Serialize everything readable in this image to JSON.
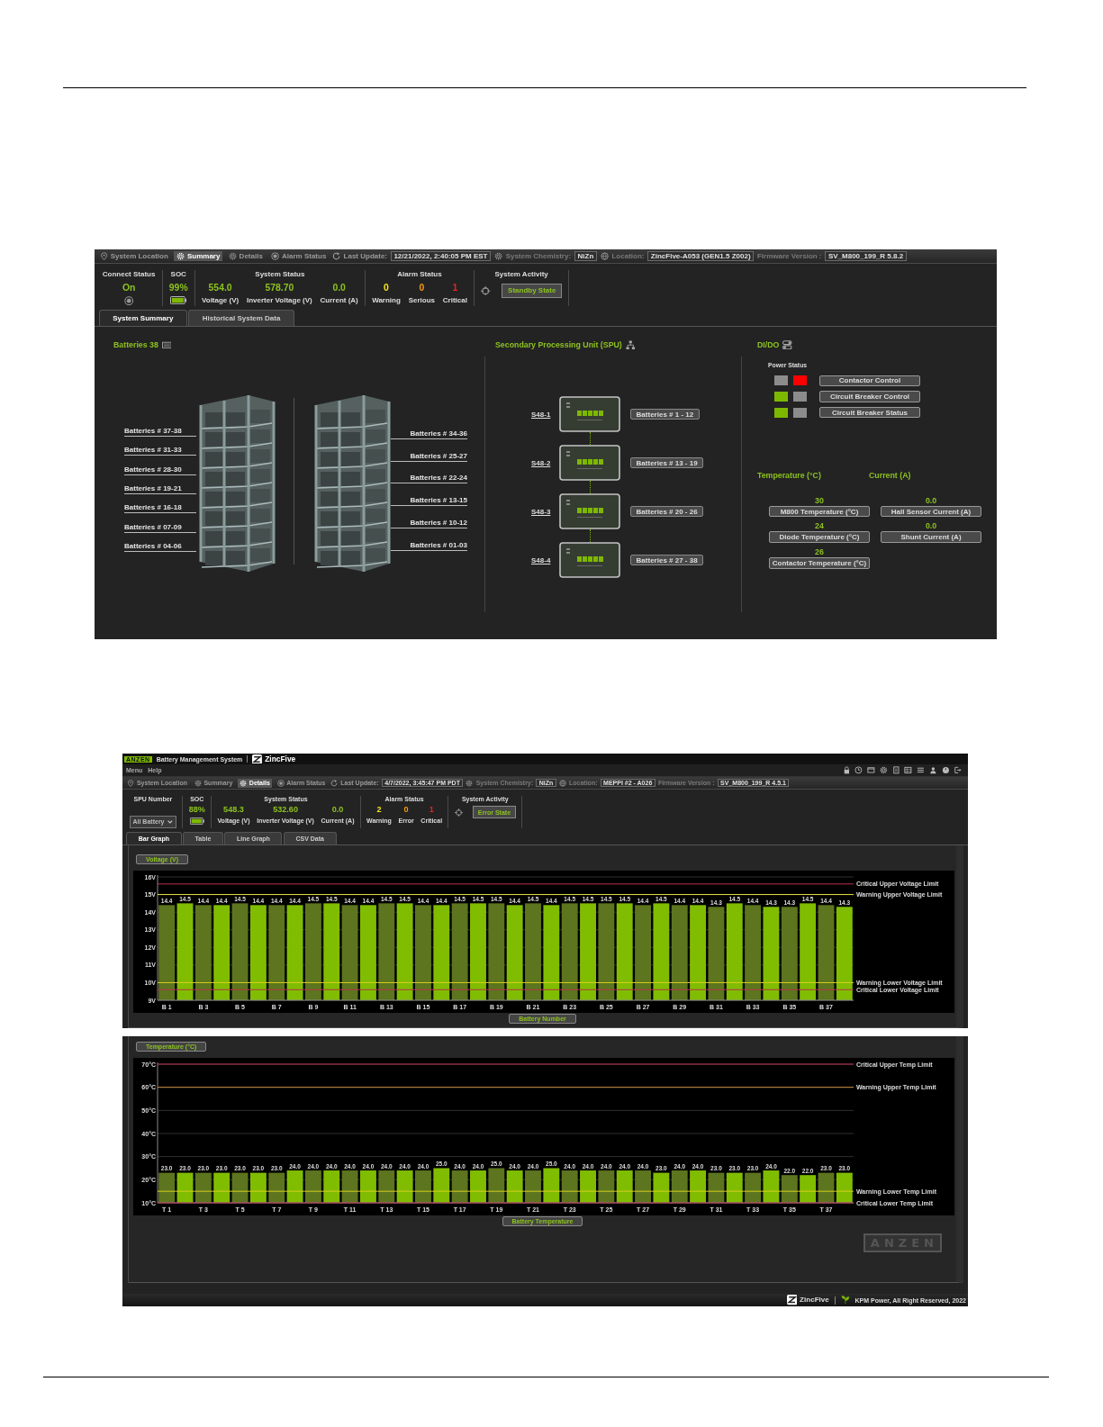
{
  "summary_screen": {
    "nav": [
      {
        "kind": "item",
        "label": "System Location",
        "selected": false
      },
      {
        "kind": "item",
        "label": "Summary",
        "selected": true
      },
      {
        "kind": "item",
        "label": "Details",
        "selected": false
      },
      {
        "kind": "item",
        "label": "Alarm Status",
        "selected": false
      },
      {
        "kind": "field",
        "label": "Last Update:",
        "value": "12/21/2022, 2:40:05 PM EST"
      },
      {
        "kind": "field",
        "label": "System Chemistry:",
        "value": "NiZn"
      },
      {
        "kind": "field",
        "label": "Location:",
        "value": "ZincFive-A053 (GEN1.5 Z002)"
      },
      {
        "kind": "field",
        "label": "Firmware Version :",
        "value": "SV_M800_199_R 5.8.2"
      }
    ],
    "status": [
      {
        "kind": "connect",
        "title": "Connect Status",
        "value": "On"
      },
      {
        "kind": "soc",
        "title": "SOC",
        "value": "99%"
      },
      {
        "kind": "readings",
        "title": "System Status",
        "items": [
          {
            "value": "554.0",
            "label": "Voltage (V)"
          },
          {
            "value": "578.70",
            "label": "Inverter Voltage (V)"
          },
          {
            "value": "0.0",
            "label": "Current (A)"
          }
        ]
      },
      {
        "kind": "alarms",
        "title": "Alarm Status",
        "items": [
          {
            "value": "0",
            "label": "Warning",
            "color": "#f2e21a"
          },
          {
            "value": "0",
            "label": "Serious",
            "color": "#f59a0c"
          },
          {
            "value": "1",
            "label": "Critical",
            "color": "#e8231c"
          }
        ]
      },
      {
        "kind": "activity",
        "title": "System Activity",
        "state": "Standby State"
      }
    ],
    "tabs": [
      {
        "label": "System Summary",
        "selected": true
      },
      {
        "label": "Historical System Data",
        "selected": false
      }
    ],
    "batteries": {
      "title": "Batteries 38",
      "left_labels": [
        "Batteries # 37-38",
        "Batteries # 31-33",
        "Batteries # 28-30",
        "Batteries # 19-21",
        "Batteries # 16-18",
        "Batteries # 07-09",
        "Batteries # 04-06"
      ],
      "right_labels": [
        "Batteries # 34-36",
        "Batteries # 25-27",
        "Batteries # 22-24",
        "Batteries # 13-15",
        "Batteries # 10-12",
        "Batteries # 01-03"
      ]
    },
    "spu": {
      "title": "Secondary Processing Unit (SPU)",
      "units": [
        {
          "name": "S48-1",
          "range": "Batteries # 1 - 12"
        },
        {
          "name": "S48-2",
          "range": "Batteries # 13 - 19"
        },
        {
          "name": "S48-3",
          "range": "Batteries # 20 - 26"
        },
        {
          "name": "S48-4",
          "range": "Batteries # 27 - 38"
        }
      ]
    },
    "dido": {
      "title": "DI/DO",
      "power_status_title": "Power Status",
      "controls": [
        {
          "indicators": [
            {
              "color": "#8c8c8c"
            },
            {
              "color": "#ff0000"
            }
          ],
          "label": "Contactor Control"
        },
        {
          "indicators": [
            {
              "color": "#7db800"
            },
            {
              "color": "#8c8c8c"
            }
          ],
          "label": "Circuit Breaker Control"
        },
        {
          "indicators": [
            {
              "color": "#7db800"
            },
            {
              "color": "#8c8c8c"
            }
          ],
          "label": "Circuit Breaker Status"
        }
      ],
      "temperature": {
        "title": "Temperature (°C)",
        "items": [
          {
            "value": "30",
            "label": "M800 Temperature (°C)"
          },
          {
            "value": "24",
            "label": "Diode Temperature (°C)"
          },
          {
            "value": "26",
            "label": "Contactor Temperature (°C)"
          }
        ]
      },
      "current": {
        "title": "Current (A)",
        "items": [
          {
            "value": "0.0",
            "label": "Hall Sensor Current (A)"
          },
          {
            "value": "0.0",
            "label": "Shunt Current (A)"
          }
        ]
      }
    }
  },
  "details_screen": {
    "header": {
      "logo": "ANZEN",
      "title": "Battery Management System",
      "brand": "ZincFive",
      "menu": [
        "Menu",
        "Help"
      ]
    },
    "nav": [
      {
        "kind": "item",
        "label": "System Location",
        "selected": false
      },
      {
        "kind": "item",
        "label": "Summary",
        "selected": false
      },
      {
        "kind": "item",
        "label": "Details",
        "selected": true
      },
      {
        "kind": "item",
        "label": "Alarm Status",
        "selected": false
      },
      {
        "kind": "field",
        "label": "Last Update:",
        "value": "4/7/2022, 3:45:47 PM PDT"
      },
      {
        "kind": "field",
        "label": "System Chemistry:",
        "value": "NiZn"
      },
      {
        "kind": "field",
        "label": "Location:",
        "value": "MEPPI #2 - A026"
      },
      {
        "kind": "field",
        "label": "Firmware Version :",
        "value": "SV_M800_199_R 4.5.1"
      }
    ],
    "status": [
      {
        "kind": "spu",
        "title": "SPU Number",
        "value": "All Battery"
      },
      {
        "kind": "soc",
        "title": "SOC",
        "value": "88%"
      },
      {
        "kind": "readings",
        "title": "System Status",
        "items": [
          {
            "value": "548.3",
            "label": "Voltage (V)"
          },
          {
            "value": "532.60",
            "label": "Inverter Voltage (V)"
          },
          {
            "value": "0.0",
            "label": "Current (A)"
          }
        ]
      },
      {
        "kind": "alarms",
        "title": "Alarm Status",
        "items": [
          {
            "value": "2",
            "label": "Warning",
            "color": "#f2e21a"
          },
          {
            "value": "0",
            "label": "Error",
            "color": "#f59a0c"
          },
          {
            "value": "1",
            "label": "Critical",
            "color": "#e8231c"
          }
        ]
      },
      {
        "kind": "activity",
        "title": "System Activity",
        "state": "Error State"
      }
    ],
    "tabs": [
      {
        "label": "Bar Graph",
        "selected": true
      },
      {
        "label": "Table",
        "selected": false
      },
      {
        "label": "Line Graph",
        "selected": false
      },
      {
        "label": "CSV Data",
        "selected": false
      }
    ],
    "charts": [
      {
        "chart_data": {
          "type": "bar",
          "title": "Voltage (V)",
          "xlabel": "Battery Number",
          "categories": [
            "B 1",
            null,
            "B 3",
            null,
            "B 5",
            null,
            "B 7",
            null,
            "B 9",
            null,
            "B 11",
            null,
            "B 13",
            null,
            "B 15",
            null,
            "B 17",
            null,
            "B 19",
            null,
            "B 21",
            null,
            "B 23",
            null,
            "B 25",
            null,
            "B 27",
            null,
            "B 29",
            null,
            "B 31",
            null,
            "B 33",
            null,
            "B 35",
            null,
            "B 37",
            null
          ],
          "grid": true,
          "series": [
            {
              "color": "#5c751e",
              "values": [
                14.4,
                null,
                14.4,
                null,
                14.5,
                null,
                14.4,
                null,
                14.5,
                null,
                14.4,
                null,
                14.5,
                null,
                14.4,
                null,
                14.5,
                null,
                14.5,
                null,
                14.5,
                null,
                14.5,
                null,
                14.5,
                null,
                14.4,
                null,
                14.4,
                null,
                14.3,
                null,
                14.4,
                null,
                14.3,
                null,
                14.4,
                null
              ],
              "value_labels": [
                "14.4",
                null,
                "14.4",
                null,
                "14.5",
                null,
                "14.4",
                null,
                "14.5",
                null,
                "14.4",
                null,
                "14.5",
                null,
                "14.4",
                null,
                "14.5",
                null,
                "14.5",
                null,
                "14.5",
                null,
                "14.5",
                null,
                "14.5",
                null,
                "14.4",
                null,
                "14.4",
                null,
                "14.3",
                null,
                "14.4",
                null,
                "14.3",
                null,
                "14.4",
                null
              ]
            },
            {
              "color": "#80bd00",
              "values": [
                null,
                14.5,
                null,
                14.4,
                null,
                14.4,
                null,
                14.4,
                null,
                14.5,
                null,
                14.4,
                null,
                14.5,
                null,
                14.4,
                null,
                14.5,
                null,
                14.4,
                null,
                14.4,
                null,
                14.5,
                null,
                14.5,
                null,
                14.5,
                null,
                14.4,
                null,
                14.5,
                null,
                14.3,
                null,
                14.5,
                null,
                14.3
              ],
              "value_labels": [
                null,
                "14.5",
                null,
                "14.4",
                null,
                "14.4",
                null,
                "14.4",
                null,
                "14.5",
                null,
                "14.4",
                null,
                "14.5",
                null,
                "14.4",
                null,
                "14.5",
                null,
                "14.4",
                null,
                "14.4",
                null,
                "14.5",
                null,
                "14.5",
                null,
                "14.5",
                null,
                "14.4",
                null,
                "14.5",
                null,
                "14.3",
                null,
                "14.5",
                null,
                "14.3"
              ]
            }
          ],
          "ylim": [
            9,
            16
          ],
          "yticks": [
            {
              "value": 9,
              "label": "9V"
            },
            {
              "value": 10,
              "label": "10V"
            },
            {
              "value": 11,
              "label": "11V"
            },
            {
              "value": 12,
              "label": "12V"
            },
            {
              "value": 13,
              "label": "13V"
            },
            {
              "value": 14,
              "label": "14V"
            },
            {
              "value": 15,
              "label": "15V"
            },
            {
              "value": 16,
              "label": "16V"
            }
          ],
          "ref_lines": [
            {
              "axis": "y",
              "value": 15.6,
              "label": "Critical Upper Voltage Limit",
              "color": "#b8304c"
            },
            {
              "axis": "y",
              "value": 15,
              "label": "Warning Upper Voltage Limit",
              "color": "#e8e040"
            },
            {
              "axis": "y",
              "value": 10,
              "label": "Warning Lower Voltage Limit",
              "color": "#d8d020"
            },
            {
              "axis": "y",
              "value": 9.6,
              "label": "Critical Lower Voltage Limit",
              "color": "#b8304c"
            }
          ]
        }
      },
      {
        "chart_data": {
          "type": "bar",
          "title": "Temperature (°C)",
          "xlabel": "Battery Temperature",
          "categories": [
            "T 1",
            null,
            "T 3",
            null,
            "T 5",
            null,
            "T 7",
            null,
            "T 9",
            null,
            "T 11",
            null,
            "T 13",
            null,
            "T 15",
            null,
            "T 17",
            null,
            "T 19",
            null,
            "T 21",
            null,
            "T 23",
            null,
            "T 25",
            null,
            "T 27",
            null,
            "T 29",
            null,
            "T 31",
            null,
            "T 33",
            null,
            "T 35",
            null,
            "T 37",
            null
          ],
          "grid": true,
          "series": [
            {
              "color": "#5c751e",
              "values": [
                23,
                null,
                23,
                null,
                23,
                null,
                23,
                null,
                24,
                null,
                24,
                null,
                24,
                null,
                24,
                null,
                24,
                null,
                25,
                null,
                24,
                null,
                24,
                null,
                24,
                null,
                24,
                null,
                24,
                null,
                23,
                null,
                23,
                null,
                22,
                null,
                23,
                null
              ],
              "value_labels": [
                "23.0",
                null,
                "23.0",
                null,
                "23.0",
                null,
                "23.0",
                null,
                "24.0",
                null,
                "24.0",
                null,
                "24.0",
                null,
                "24.0",
                null,
                "24.0",
                null,
                "25.0",
                null,
                "24.0",
                null,
                "24.0",
                null,
                "24.0",
                null,
                "24.0",
                null,
                "24.0",
                null,
                "23.0",
                null,
                "23.0",
                null,
                "22.0",
                null,
                "23.0",
                null
              ]
            },
            {
              "color": "#80bd00",
              "values": [
                null,
                23,
                null,
                23,
                null,
                23,
                null,
                24,
                null,
                24,
                null,
                24,
                null,
                24,
                null,
                25,
                null,
                24,
                null,
                24,
                null,
                25,
                null,
                24,
                null,
                24,
                null,
                23,
                null,
                24,
                null,
                23,
                null,
                24,
                null,
                22,
                null,
                23
              ],
              "value_labels": [
                null,
                "23.0",
                null,
                "23.0",
                null,
                "23.0",
                null,
                "24.0",
                null,
                "24.0",
                null,
                "24.0",
                null,
                "24.0",
                null,
                "25.0",
                null,
                "24.0",
                null,
                "24.0",
                null,
                "25.0",
                null,
                "24.0",
                null,
                "24.0",
                null,
                "23.0",
                null,
                "24.0",
                null,
                "23.0",
                null,
                "24.0",
                null,
                "22.0",
                null,
                "23.0"
              ]
            }
          ],
          "ylim": [
            10,
            70
          ],
          "yticks": [
            {
              "value": 10,
              "label": "10°C"
            },
            {
              "value": 20,
              "label": "20°C"
            },
            {
              "value": 30,
              "label": "30°C"
            },
            {
              "value": 40,
              "label": "40°C"
            },
            {
              "value": 50,
              "label": "50°C"
            },
            {
              "value": 60,
              "label": "60°C"
            },
            {
              "value": 70,
              "label": "70°C"
            }
          ],
          "ref_lines": [
            {
              "axis": "y",
              "value": 70,
              "label": "Critical Upper Temp Limit",
              "color": "#b8304c"
            },
            {
              "axis": "y",
              "value": 60,
              "label": "Warning Upper Temp Limit",
              "color": "#c88a40"
            },
            {
              "axis": "y",
              "value": 15,
              "label": "Warning Lower Temp Limit",
              "color": "#d8d020"
            },
            {
              "axis": "y",
              "value": 10,
              "label": "Critical Lower Temp Limit",
              "color": "#b8304c"
            }
          ]
        }
      }
    ],
    "corner_logo": "ANZEN",
    "footer": {
      "brand": "ZincFive",
      "copyright": "KPM Power, All Right Reserved, 2022"
    }
  }
}
